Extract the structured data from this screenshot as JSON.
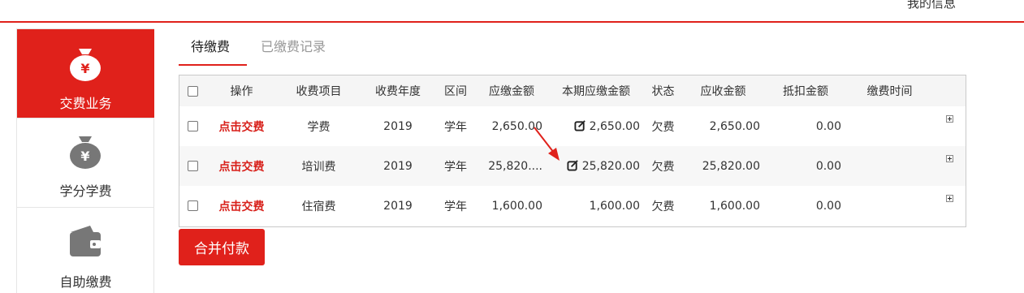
{
  "header": {
    "my_info": "我的信息"
  },
  "sidebar": {
    "items": [
      {
        "label": "交费业务",
        "icon": "money-bag-icon",
        "active": true
      },
      {
        "label": "学分学费",
        "icon": "money-bag-icon",
        "active": false
      },
      {
        "label": "自助缴费",
        "icon": "wallet-icon",
        "active": false
      }
    ]
  },
  "tabs": [
    {
      "label": "待缴费",
      "active": true
    },
    {
      "label": "已缴费记录",
      "active": false
    }
  ],
  "table": {
    "headers": [
      "操作",
      "收费项目",
      "收费年度",
      "区间",
      "应缴金额",
      "本期应缴金额",
      "状态",
      "应收金额",
      "抵扣金额",
      "缴费时间"
    ],
    "rows": [
      {
        "action": "点击交费",
        "item": "学费",
        "year": "2019",
        "period": "学年",
        "due": "2,650.00",
        "current_due": "2,650.00",
        "status": "欠费",
        "receivable": "2,650.00",
        "deduction": "0.00",
        "pay_time": ""
      },
      {
        "action": "点击交费",
        "item": "培训费",
        "year": "2019",
        "period": "学年",
        "due": "25,820....",
        "current_due": "25,820.00",
        "status": "欠费",
        "receivable": "25,820.00",
        "deduction": "0.00",
        "pay_time": ""
      },
      {
        "action": "点击交费",
        "item": "住宿费",
        "year": "2019",
        "period": "学年",
        "due": "1,600.00",
        "current_due": "1,600.00",
        "status": "欠费",
        "receivable": "1,600.00",
        "deduction": "0.00",
        "pay_time": ""
      }
    ]
  },
  "buttons": {
    "merge_pay": "合并付款"
  },
  "colors": {
    "accent": "#e0211b",
    "link": "#d8201a"
  }
}
